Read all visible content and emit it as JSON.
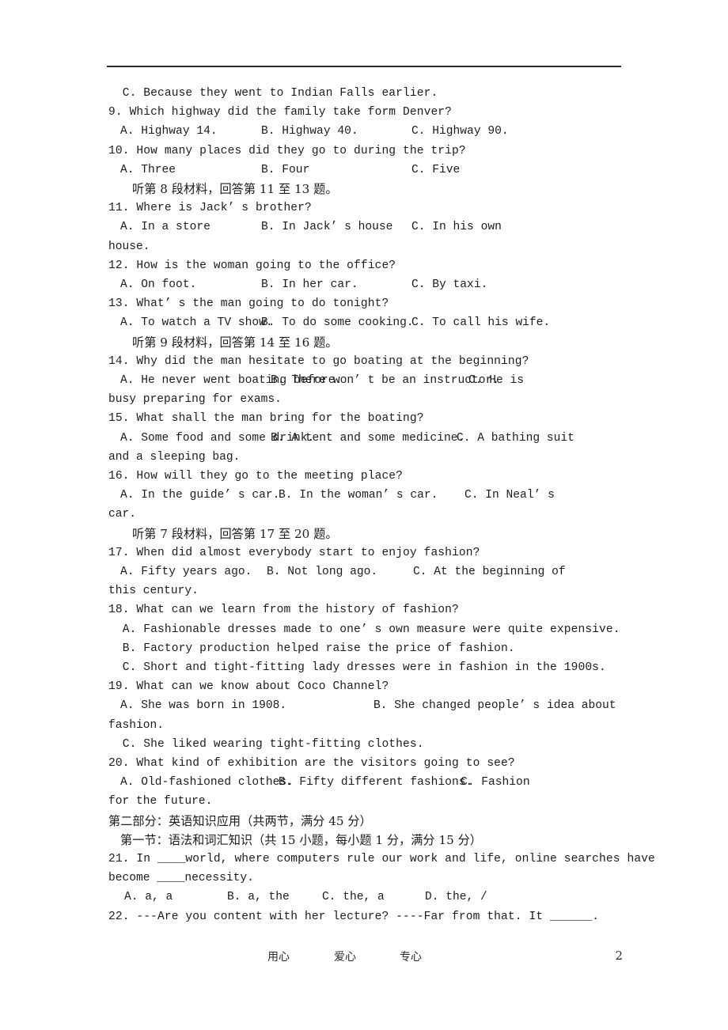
{
  "document": {
    "page_number": "2",
    "footer_words": [
      "用心",
      "爱心",
      "专心"
    ]
  },
  "lines": {
    "l8c": "  C. Because they went to Indian Falls earlier.",
    "q9": "9. Which highway did the family take form Denver?",
    "q9a": "A. Highway 14.",
    "q9b": "B. Highway 40.",
    "q9c": "C. Highway 90.",
    "q10": "10. How many places did they go to during the trip?",
    "q10a": "A. Three",
    "q10b": "B. Four",
    "q10c": "C. Five",
    "dir8": "听第 8 段材料，回答第 11 至 13 题。",
    "q11": "11. Where is Jack’ s brother?",
    "q11a": "A. In a store",
    "q11b": "B. In Jack’ s house",
    "q11c": "C. In his own",
    "q11cont": "house.",
    "q12": "12. How is the woman going to the office?",
    "q12a": "A. On foot.",
    "q12b": "B. In her car.",
    "q12c": "C. By taxi.",
    "q13": "13. What’ s the man going to do tonight?",
    "q13a": "A. To watch a TV show.",
    "q13b": "B. To do some cooking.",
    "q13c": "C. To call his wife.",
    "dir9": "听第 9 段材料，回答第 14 至 16 题。",
    "q14": "14. Why did the man hesitate to go boating at the beginning?",
    "q14a": "A. He never went boating before.",
    "q14b": "B. There won’ t be an instructor.",
    "q14c": "C. He is",
    "q14cont": "busy preparing for exams.",
    "q15": "15. What shall the man bring for the boating?",
    "q15a": "A. Some food and some drink.",
    "q15b": "B. A tent and some medicine.",
    "q15c": "C. A bathing suit",
    "q15cont": "and a sleeping bag.",
    "q16": "16. How will they go to the meeting place?",
    "q16a": "A. In the guide’ s car.",
    "q16b": "B. In the woman’ s car.",
    "q16c": "C. In Neal’ s",
    "q16cont": "car.",
    "dir7": "听第 7 段材料，回答第 17 至 20 题。",
    "q17": "17. When did almost everybody start to enjoy fashion?",
    "q17a": "A. Fifty years ago.",
    "q17b": "B. Not long ago.",
    "q17c": "C. At the beginning of",
    "q17cont": "this century.",
    "q18": "18. What can we learn from the history of fashion?",
    "q18a": "  A. Fashionable dresses made to one’ s own measure were quite expensive.",
    "q18b": "  B. Factory production helped raise the price of fashion.",
    "q18c": "  C. Short and tight-fitting lady dresses were in fashion in the 1900s.",
    "q19": "19. What can we know about Coco Channel?",
    "q19a": "A. She was born in 1908.",
    "q19b": "B. She changed people’ s idea about",
    "q19cont": "fashion.",
    "q19c": "  C. She liked wearing tight-fitting clothes.",
    "q20": "20. What kind of exhibition are the visitors going to see?",
    "q20a": "A. Old-fashioned clothes.",
    "q20b": "B. Fifty different fashions.",
    "q20c": "C. Fashion",
    "q20cont": "for the future.",
    "part2": "第二部分：英语知识应用（共两节，满分 45 分）",
    "section1": "第一节：语法和词汇知识（共 15 小题，每小题 1 分，满分 15 分）",
    "q21": "21. In ____world, where computers rule our work and life, online searches have",
    "q21cont": "become ____necessity.",
    "q21a": "A. a, a",
    "q21b": "B. a, the",
    "q21c": "C. the, a",
    "q21d": "D. the, /",
    "q22": "22. ---Are you content with her lecture? ----Far from that. It ______."
  }
}
